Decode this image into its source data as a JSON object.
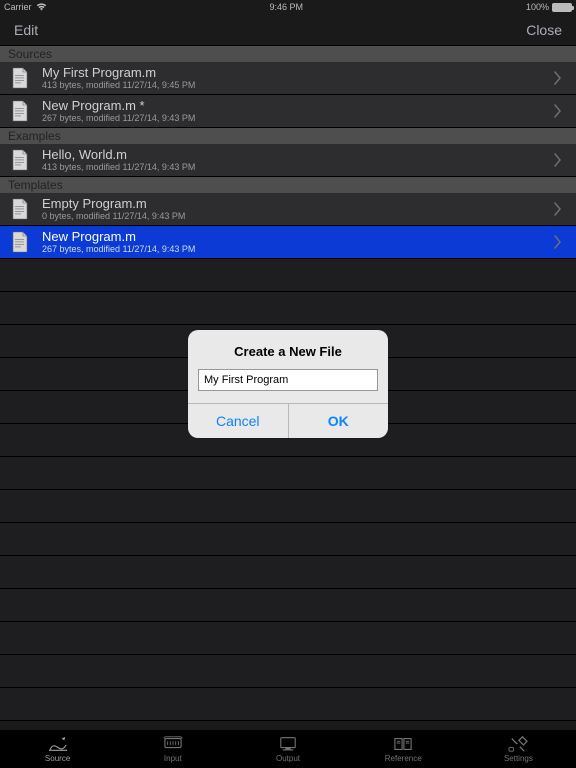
{
  "status": {
    "carrier": "Carrier",
    "time": "9:46 PM",
    "battery": "100%"
  },
  "nav": {
    "left": "Edit",
    "right": "Close"
  },
  "sections": [
    {
      "title": "Sources",
      "rows": [
        {
          "name": "My First Program.m",
          "meta": "413 bytes, modified 11/27/14, 9:45 PM",
          "selected": false
        },
        {
          "name": "New Program.m *",
          "meta": "267 bytes, modified 11/27/14, 9:43 PM",
          "selected": false
        }
      ]
    },
    {
      "title": "Examples",
      "rows": [
        {
          "name": "Hello, World.m",
          "meta": "413 bytes, modified 11/27/14, 9:43 PM",
          "selected": false
        }
      ]
    },
    {
      "title": "Templates",
      "rows": [
        {
          "name": "Empty Program.m",
          "meta": "0 bytes, modified 11/27/14, 9:43 PM",
          "selected": false
        },
        {
          "name": "New Program.m",
          "meta": "267 bytes, modified 11/27/14, 9:43 PM",
          "selected": true
        }
      ]
    }
  ],
  "dialog": {
    "title": "Create a New File",
    "value": "My First Program",
    "cancel": "Cancel",
    "ok": "OK"
  },
  "tabs": {
    "items": [
      {
        "label": "Source",
        "active": true
      },
      {
        "label": "Input",
        "active": false
      },
      {
        "label": "Output",
        "active": false
      },
      {
        "label": "Reference",
        "active": false
      },
      {
        "label": "Settings",
        "active": false
      }
    ]
  }
}
